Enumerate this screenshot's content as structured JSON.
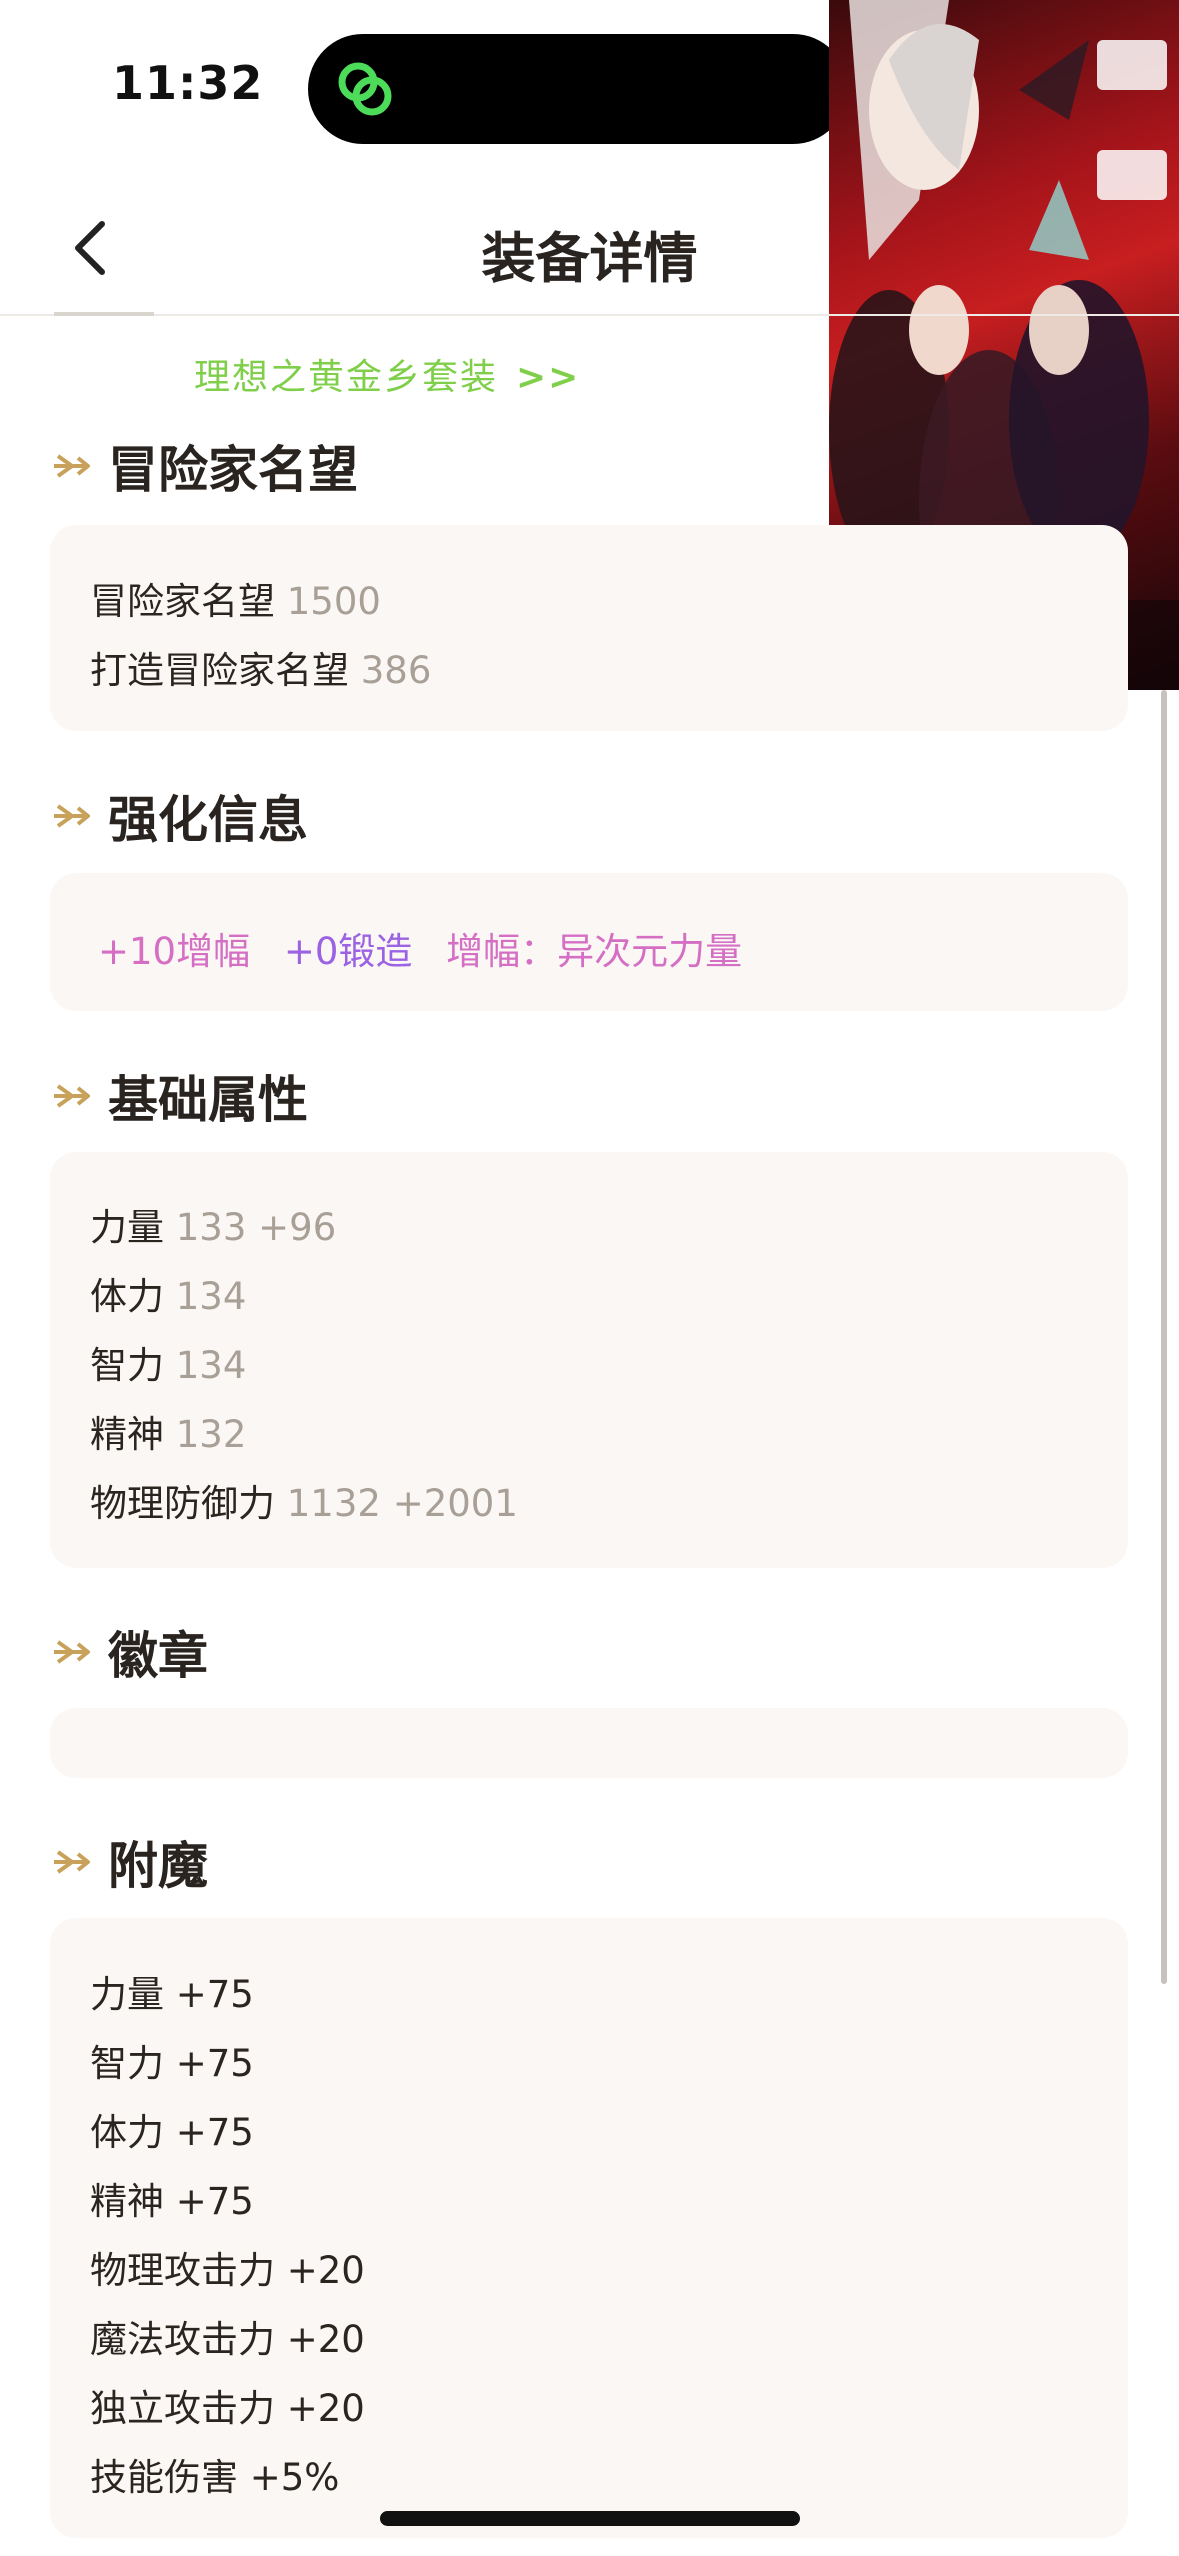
{
  "status_bar": {
    "time": "11:32"
  },
  "header": {
    "title": "装备详情"
  },
  "set_link": {
    "label": "理想之黄金乡套装",
    "chevron": ">>"
  },
  "sections": {
    "fame": {
      "title": "冒险家名望",
      "rows": [
        {
          "label": "冒险家名望",
          "value": "1500"
        },
        {
          "label": "打造冒险家名望",
          "value": "386"
        }
      ]
    },
    "enhance": {
      "title": "强化信息",
      "items": [
        {
          "text": "+10增幅",
          "color": "#d46fc4"
        },
        {
          "text": "+0锻造",
          "color": "#9b62e3"
        },
        {
          "text": "增幅：异次元力量",
          "color": "#d46fc4"
        }
      ]
    },
    "base": {
      "title": "基础属性",
      "rows": [
        {
          "label": "力量",
          "value": "133 +96"
        },
        {
          "label": "体力",
          "value": "134"
        },
        {
          "label": "智力",
          "value": "134"
        },
        {
          "label": "精神",
          "value": "132"
        },
        {
          "label": "物理防御力",
          "value": "1132 +2001"
        }
      ]
    },
    "emblem": {
      "title": "徽章"
    },
    "enchant": {
      "title": "附魔",
      "rows": [
        "力量 +75",
        "智力 +75",
        "体力 +75",
        "精神 +75",
        "物理攻击力 +20",
        "魔法攻击力 +20",
        "独立攻击力 +20",
        "技能伤害 +5%"
      ]
    }
  },
  "colors": {
    "accent_gold": "#c8a25a",
    "set_link_green": "#7fcf4a",
    "card_bg": "#fbf7f4",
    "value_gray": "#a89f96"
  },
  "icons": {
    "back": "chevron-left-icon",
    "section": "arrow-right-icon",
    "island_app": "link-rings-icon"
  }
}
